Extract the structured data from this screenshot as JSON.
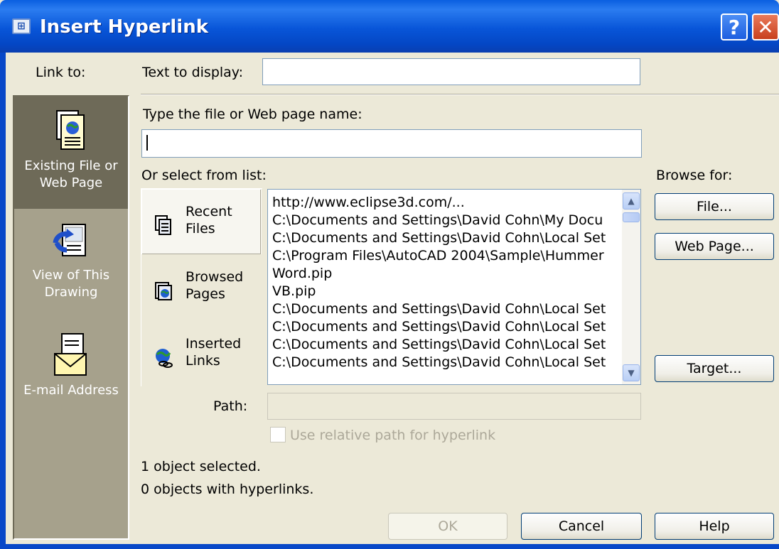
{
  "window": {
    "title": "Insert Hyperlink",
    "help_button": "?",
    "close_button": "✕"
  },
  "link_to": {
    "label": "Link to:",
    "items": [
      {
        "label_line1": "Existing File or",
        "label_line2": "Web Page",
        "icon": "document-globe-icon",
        "selected": true
      },
      {
        "label_line1": "View of This",
        "label_line2": "Drawing",
        "icon": "drawing-view-icon",
        "selected": false
      },
      {
        "label_line1": "E-mail Address",
        "label_line2": "",
        "icon": "envelope-icon",
        "selected": false
      }
    ]
  },
  "text_to_display": {
    "label": "Text to display:",
    "value": ""
  },
  "file_name": {
    "label": "Type the file or Web page name:",
    "value": ""
  },
  "select_list": {
    "label": "Or select from list:",
    "tabs": [
      {
        "line1": "Recent",
        "line2": "Files",
        "icon": "recent-files-icon",
        "selected": true
      },
      {
        "line1": "Browsed",
        "line2": "Pages",
        "icon": "browsed-pages-icon",
        "selected": false
      },
      {
        "line1": "Inserted",
        "line2": "Links",
        "icon": "inserted-links-icon",
        "selected": false
      }
    ],
    "items": [
      "http://www.eclipse3d.com/...",
      "C:\\Documents and Settings\\David Cohn\\My Docu",
      "C:\\Documents and Settings\\David Cohn\\Local Set",
      "C:\\Program Files\\AutoCAD 2004\\Sample\\Hummer",
      "Word.pip",
      "VB.pip",
      "C:\\Documents and Settings\\David Cohn\\Local Set",
      "C:\\Documents and Settings\\David Cohn\\Local Set",
      "C:\\Documents and Settings\\David Cohn\\Local Set",
      "C:\\Documents and Settings\\David Cohn\\Local Set"
    ]
  },
  "browse": {
    "label": "Browse for:",
    "file_button": "File...",
    "web_page_button": "Web Page...",
    "target_button": "Target..."
  },
  "path": {
    "label": "Path:",
    "value": ""
  },
  "relative_path": {
    "label": "Use relative path for hyperlink",
    "checked": false
  },
  "status": {
    "line1": "1 object selected.",
    "line2": "0 objects with hyperlinks."
  },
  "buttons": {
    "ok": "OK",
    "cancel": "Cancel",
    "help": "Help"
  }
}
